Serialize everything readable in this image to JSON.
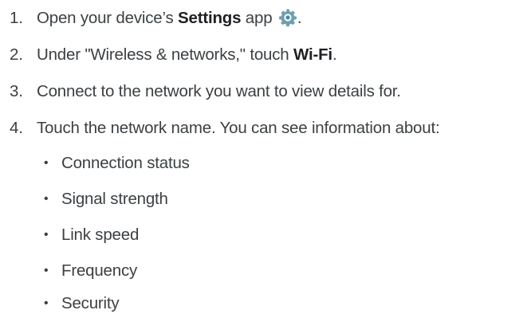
{
  "steps": [
    {
      "number": "1.",
      "text_before": "Open your device’s ",
      "bold": "Settings",
      "text_after": " app",
      "icon": "settings-gear-icon",
      "trailing": "."
    },
    {
      "number": "2.",
      "text_before": "Under \"Wireless & networks,\" touch ",
      "bold": "Wi-Fi",
      "trailing": "."
    },
    {
      "number": "3.",
      "text": "Connect to the network you want to view details for."
    },
    {
      "number": "4.",
      "text": "Touch the network name. You can see information about:"
    }
  ],
  "details": [
    "Connection status",
    "Signal strength",
    "Link speed",
    "Frequency",
    "Security"
  ],
  "bullet_char": "•",
  "colors": {
    "text": "#3c4043",
    "bold_text": "#202124",
    "gear_icon": "#6f9fb0"
  }
}
